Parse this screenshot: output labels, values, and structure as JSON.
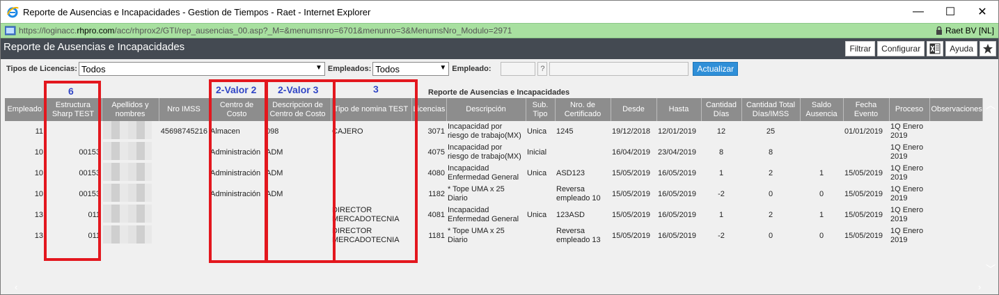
{
  "window": {
    "title": "Reporte de Ausencias e Incapacidades - Gestion de Tiempos - Raet - Internet Explorer",
    "minimize": "—",
    "maximize": "☐",
    "close": "✕"
  },
  "address": {
    "prefix": "https://loginacc.",
    "domain": "rhpro.com",
    "path": "/acc/rhprox2/GTI/rep_ausencias_00.asp?_M=&menumsnro=6701&menunro=3&MenumsNro_Modulo=2971",
    "cert": "Raet BV [NL]"
  },
  "app": {
    "title": "Reporte de Ausencias e Incapacidades",
    "buttons": {
      "filtrar": "Filtrar",
      "configurar": "Configurar",
      "ayuda": "Ayuda"
    }
  },
  "filters": {
    "tipos_label": "Tipos de Licencias:",
    "tipos_value": "Todos",
    "empleados_label": "Empleados:",
    "empleados_value": "Todos",
    "empleado_label": "Empleado:",
    "help_mark": "?",
    "actualizar": "Actualizar"
  },
  "report_subtitle": "Reporte de Ausencias e Incapacidades",
  "annotations": {
    "a1": "6",
    "a2": "2-Valor 2",
    "a3": "2-Valor 3",
    "a4": "3"
  },
  "table": {
    "headers": [
      "Empleado",
      "Estructura Sharp TEST",
      "Apellidos y nombres",
      "Nro IMSS",
      "Centro de Costo",
      "Descripcion de Centro de Costo",
      "Tipo de nomina TEST",
      "Licencias",
      "Descripción",
      "Sub. Tipo",
      "Nro. de Certificado",
      "Desde",
      "Hasta",
      "Cantidad Días",
      "Cantidad Total Días/IMSS",
      "Saldo Ausencia",
      "Fecha Evento",
      "Proceso",
      "Observaciones"
    ],
    "rows": [
      [
        "11",
        "",
        "",
        "45698745216",
        "Almacen",
        "098",
        "CAJERO",
        "3071",
        "Incapacidad por riesgo de trabajo(MX)",
        "Unica",
        "1245",
        "19/12/2018",
        "12/01/2019",
        "12",
        "25",
        "",
        "01/01/2019",
        "1Q Enero 2019",
        ""
      ],
      [
        "10",
        "00153",
        "",
        "",
        "Administración",
        "ADM",
        "",
        "4075",
        "Incapacidad por riesgo de trabajo(MX)",
        "Inicial",
        "",
        "16/04/2019",
        "23/04/2019",
        "8",
        "8",
        "",
        "",
        "1Q Enero 2019",
        ""
      ],
      [
        "10",
        "00153",
        "",
        "",
        "Administración",
        "ADM",
        "",
        "4080",
        "Incapacidad Enfermedad General",
        "Unica",
        "ASD123",
        "15/05/2019",
        "16/05/2019",
        "1",
        "2",
        "1",
        "15/05/2019",
        "1Q Enero 2019",
        ""
      ],
      [
        "10",
        "00153",
        "",
        "",
        "Administración",
        "ADM",
        "",
        "1182",
        "* Tope UMA x 25 Diario",
        "",
        "Reversa empleado 10",
        "15/05/2019",
        "16/05/2019",
        "-2",
        "0",
        "0",
        "15/05/2019",
        "1Q Enero 2019",
        ""
      ],
      [
        "13",
        "011",
        "",
        "",
        "",
        "",
        "DIRECTOR MERCADOTECNIA",
        "4081",
        "Incapacidad Enfermedad General",
        "Unica",
        "123ASD",
        "15/05/2019",
        "16/05/2019",
        "1",
        "2",
        "1",
        "15/05/2019",
        "1Q Enero 2019",
        ""
      ],
      [
        "13",
        "011",
        "",
        "",
        "",
        "",
        "DIRECTOR MERCADOTECNIA",
        "1181",
        "* Tope UMA x 25 Diario",
        "",
        "Reversa empleado 13",
        "15/05/2019",
        "16/05/2019",
        "-2",
        "0",
        "0",
        "15/05/2019",
        "1Q Enero 2019",
        ""
      ]
    ]
  }
}
